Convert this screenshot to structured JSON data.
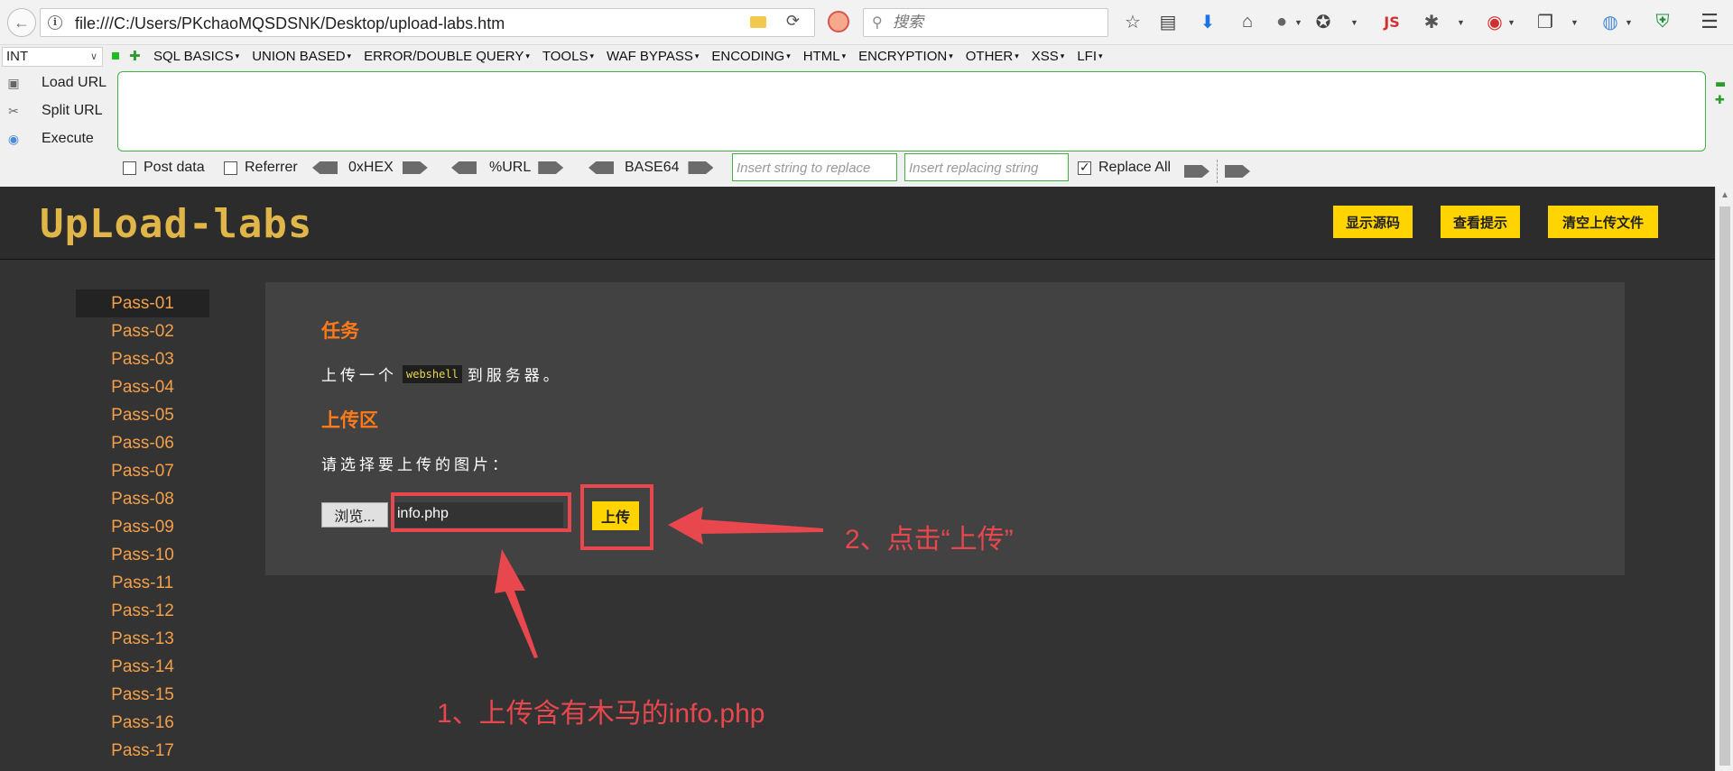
{
  "browser": {
    "url": "file:///C:/Users/PKchaoMQSDSNK/Desktop/upload-labs.htm",
    "search_placeholder": "搜索",
    "js_label": "JS"
  },
  "hackbar": {
    "select_value": "INT",
    "menu": [
      "SQL BASICS",
      "UNION BASED",
      "ERROR/DOUBLE QUERY",
      "TOOLS",
      "WAF BYPASS",
      "ENCODING",
      "HTML",
      "ENCRYPTION",
      "OTHER",
      "XSS",
      "LFI"
    ],
    "actions": {
      "load": "Load URL",
      "split": "Split URL",
      "execute": "Execute"
    },
    "options": {
      "post_data": "Post data",
      "referrer": "Referrer",
      "hex": "0xHEX",
      "url": "%URL",
      "base64": "BASE64",
      "replace_placeholder": "Insert string to replace",
      "replacing_placeholder": "Insert replacing string",
      "replace_all": "Replace All"
    }
  },
  "page": {
    "logo": "UpLoad-labs",
    "header_buttons": [
      "显示源码",
      "查看提示",
      "清空上传文件"
    ],
    "sidebar": [
      "Pass-01",
      "Pass-02",
      "Pass-03",
      "Pass-04",
      "Pass-05",
      "Pass-06",
      "Pass-07",
      "Pass-08",
      "Pass-09",
      "Pass-10",
      "Pass-11",
      "Pass-12",
      "Pass-13",
      "Pass-14",
      "Pass-15",
      "Pass-16",
      "Pass-17"
    ],
    "task": {
      "title": "任务",
      "text_before": "上传一个",
      "code": "webshell",
      "text_after": "到服务器。",
      "upload_title": "上传区",
      "upload_prompt": "请选择要上传的图片：",
      "browse_label": "浏览...",
      "file_value": "info.php",
      "upload_label": "上传"
    }
  },
  "annotations": {
    "step1": "1、上传含有木马的info.php",
    "step2": "2、点击“上传”"
  },
  "colors": {
    "accent_orange": "#ff7a1a",
    "pass_link": "#f4a04a",
    "button_yellow": "#ffd400",
    "annotation_red": "#e8474d"
  }
}
